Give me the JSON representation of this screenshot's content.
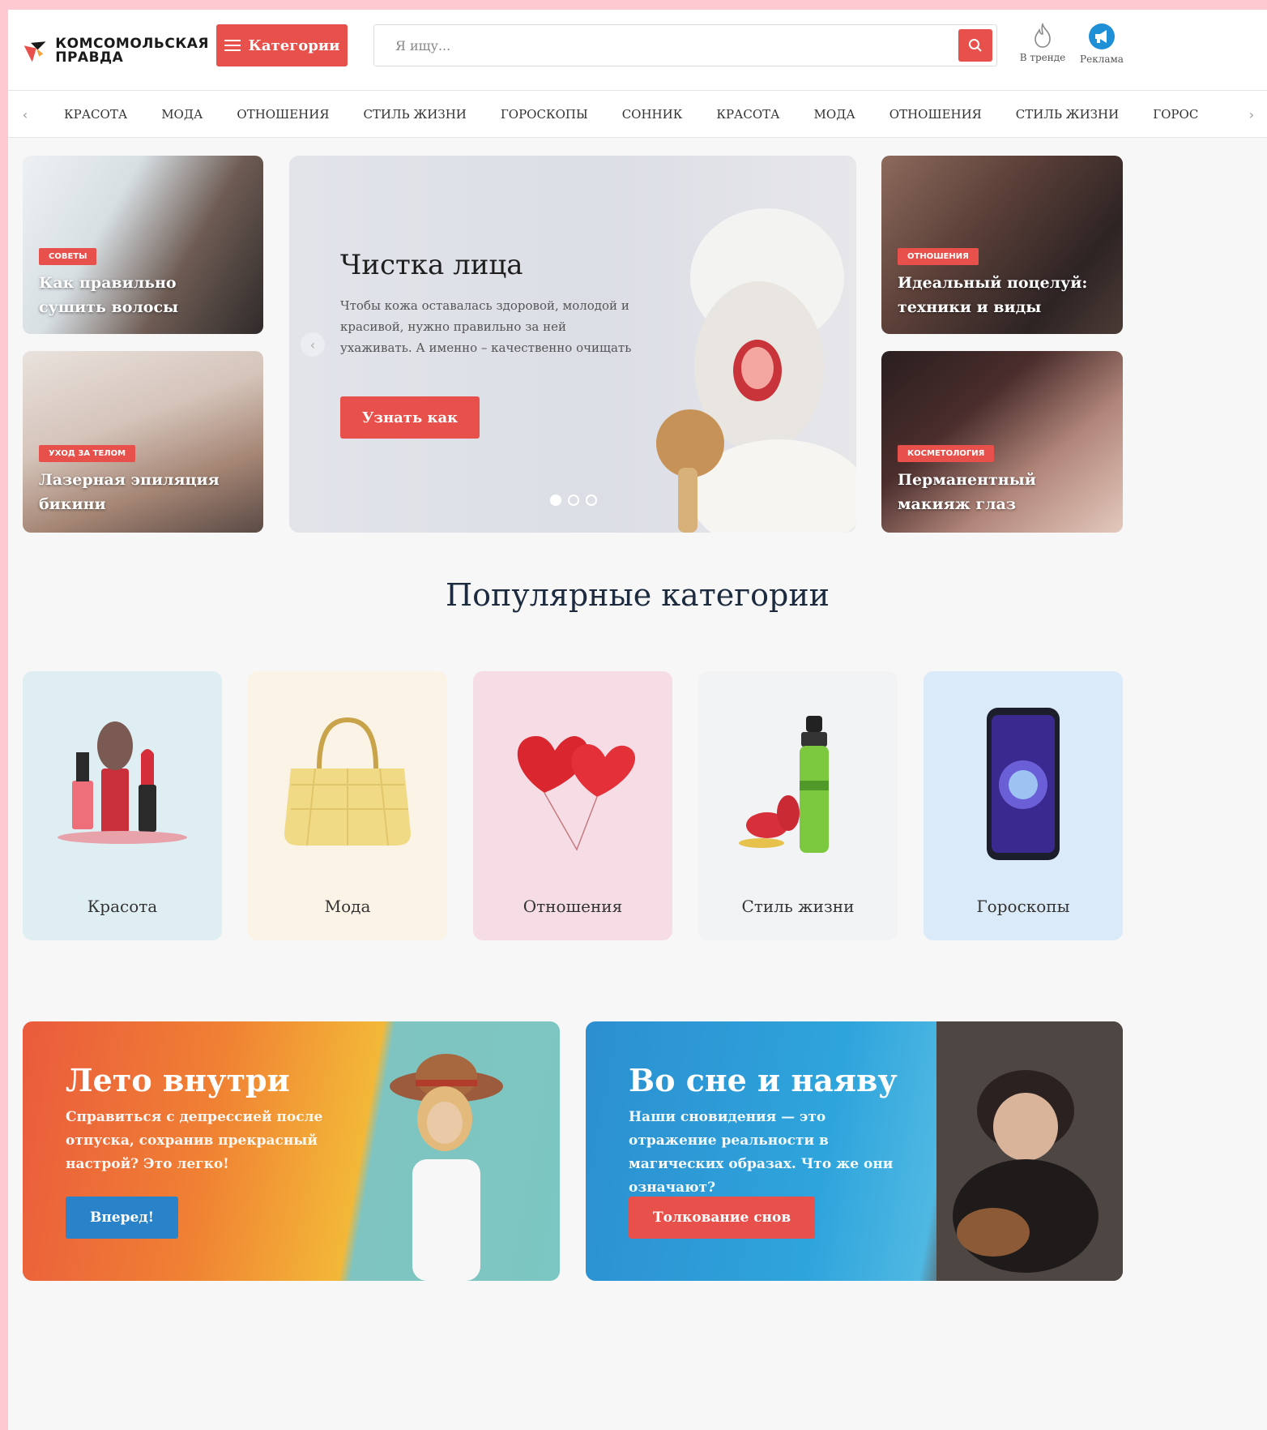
{
  "header": {
    "logo_line1": "Комсомольская",
    "logo_line2": "Правда",
    "categories_label": "Категории",
    "search_placeholder": "Я ищу...",
    "trend_label": "В тренде",
    "ads_label": "Реклама"
  },
  "nav": {
    "items": [
      "КРАСОТА",
      "МОДА",
      "ОТНОШЕНИЯ",
      "СТИЛЬ ЖИЗНИ",
      "ГОРОСКОПЫ",
      "СОННИК",
      "КРАСОТА",
      "МОДА",
      "ОТНОШЕНИЯ",
      "СТИЛЬ ЖИЗНИ",
      "ГОРОС"
    ]
  },
  "hero": {
    "left_top": {
      "label": "СОВЕТЫ",
      "title": "Как правильно сушить волосы"
    },
    "left_bottom": {
      "label": "УХОД ЗА ТЕЛОМ",
      "title": "Лазерная эпиляция бикини"
    },
    "right_top": {
      "label": "ОТНОШЕНИЯ",
      "title": "Идеальный поцелуй: техники и виды"
    },
    "right_bottom": {
      "label": "КОСМЕТОЛОГИЯ",
      "title": "Перманентный макияж глаз"
    },
    "slide": {
      "title": "Чистка лица",
      "text": "Чтобы кожа оставалась здоровой, молодой и красивой, нужно правильно за ней ухаживать. А именно – качественно очищать",
      "button": "Узнать как"
    }
  },
  "popular": {
    "title": "Популярные категории",
    "categories": [
      "Красота",
      "Мода",
      "Отношения",
      "Стиль жизни",
      "Гороскопы"
    ]
  },
  "promos": {
    "summer": {
      "title": "Лето внутри",
      "text": "Справиться с депрессией после отпуска, сохранив прекрасный настрой? Это легко!",
      "button": "Вперед!"
    },
    "dreams": {
      "title": "Во сне и наяву",
      "text": "Наши сновидения — это отражение реальности в магических образах. Что же они означают?",
      "button": "Толкование снов"
    }
  },
  "colors": {
    "accent": "#e8514b",
    "blue": "#2a83c9",
    "heading": "#1c2b3f"
  }
}
